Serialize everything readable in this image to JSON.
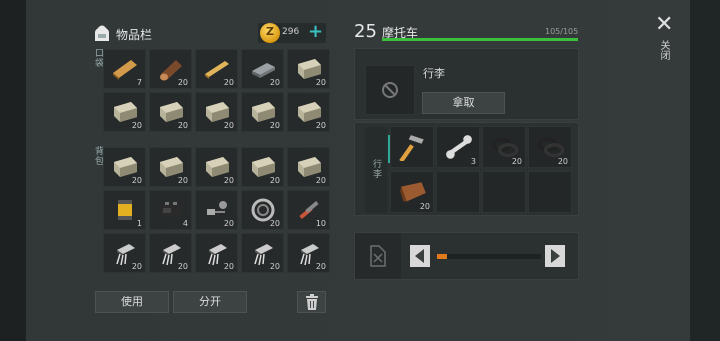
{
  "inventory": {
    "title": "物品栏",
    "coins": "296",
    "coin_symbol": "Z",
    "add_symbol": "+",
    "section_pockets": "口袋",
    "section_backpack": "背包",
    "pocket_slots": [
      {
        "item": "wood-plank",
        "count": "7"
      },
      {
        "item": "log",
        "count": "20"
      },
      {
        "item": "board",
        "count": "20"
      },
      {
        "item": "iron-ingot",
        "count": "20"
      },
      {
        "item": "stone",
        "count": "20"
      },
      {
        "item": "stone",
        "count": "20"
      },
      {
        "item": "stone",
        "count": "20"
      },
      {
        "item": "stone",
        "count": "20"
      },
      {
        "item": "stone",
        "count": "20"
      },
      {
        "item": "stone",
        "count": "20"
      }
    ],
    "backpack_slots": [
      {
        "item": "stone",
        "count": "20"
      },
      {
        "item": "stone",
        "count": "20"
      },
      {
        "item": "stone",
        "count": "20"
      },
      {
        "item": "stone",
        "count": "20"
      },
      {
        "item": "stone",
        "count": "20"
      },
      {
        "item": "oil-filter",
        "count": "1"
      },
      {
        "item": "battery",
        "count": "4"
      },
      {
        "item": "bolts",
        "count": "20"
      },
      {
        "item": "bearing",
        "count": "20"
      },
      {
        "item": "tools",
        "count": "10"
      },
      {
        "item": "transistor",
        "count": "20"
      },
      {
        "item": "transistor",
        "count": "20"
      },
      {
        "item": "transistor",
        "count": "20"
      },
      {
        "item": "transistor",
        "count": "20"
      },
      {
        "item": "transistor",
        "count": "20"
      }
    ],
    "use_label": "使用",
    "split_label": "分开"
  },
  "vehicle": {
    "level": "25",
    "name": "摩托车",
    "hp": "105/105",
    "hp_fraction": 1.0,
    "equip_label": "行李",
    "take_label": "拿取",
    "trunk_label": "行李",
    "trunk_slots": [
      {
        "item": "hammer",
        "count": ""
      },
      {
        "item": "wrench",
        "count": "3"
      },
      {
        "item": "rubber-rings",
        "count": "20"
      },
      {
        "item": "rubber-rings",
        "count": "20"
      },
      {
        "item": "leather",
        "count": "20"
      },
      {
        "item": "empty",
        "count": ""
      },
      {
        "item": "empty",
        "count": ""
      },
      {
        "item": "empty",
        "count": ""
      }
    ],
    "fuel_fraction": 0.1
  },
  "close_label": "关闭",
  "close_symbol": "✕"
}
